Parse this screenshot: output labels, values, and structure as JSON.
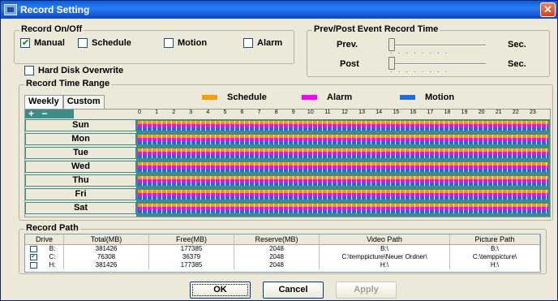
{
  "window": {
    "title": "Record Setting",
    "close_glyph": "✕"
  },
  "record_onoff": {
    "legend": "Record On/Off",
    "manual": {
      "label": "Manual",
      "checked": true
    },
    "schedule": {
      "label": "Schedule",
      "checked": false
    },
    "motion": {
      "label": "Motion",
      "checked": false
    },
    "alarm": {
      "label": "Alarm",
      "checked": false
    }
  },
  "hard_disk_overwrite": {
    "label": "Hard Disk Overwrite",
    "checked": false
  },
  "event_time": {
    "legend": "Prev/Post Event Record Time",
    "prev_label": "Prev.",
    "post_label": "Post",
    "unit": "Sec.",
    "prev_value_fraction": 0,
    "post_value_fraction": 0
  },
  "time_range": {
    "legend": "Record Time Range",
    "tabs": [
      "Weekly",
      "Custom"
    ],
    "legend_items": [
      {
        "label": "Schedule",
        "color": "#ff9900"
      },
      {
        "label": "Alarm",
        "color": "#ff00ff"
      },
      {
        "label": "Motion",
        "color": "#1a6fe0"
      }
    ],
    "tool_plus": "+",
    "tool_minus": "−",
    "hours": [
      "0",
      "1",
      "2",
      "3",
      "4",
      "5",
      "6",
      "7",
      "8",
      "9",
      "10",
      "11",
      "12",
      "13",
      "14",
      "15",
      "16",
      "17",
      "18",
      "19",
      "20",
      "21",
      "22",
      "23"
    ],
    "days": [
      "Sun",
      "Mon",
      "Tue",
      "Wed",
      "Thu",
      "Fri",
      "Sat"
    ]
  },
  "record_path": {
    "legend": "Record Path",
    "columns": [
      "Drive",
      "Total(MB)",
      "Free(MB)",
      "Reserve(MB)",
      "Video Path",
      "Picture Path"
    ],
    "rows": [
      {
        "checked": false,
        "drive": "B:",
        "total": "381426",
        "free": "177385",
        "reserve": "2048",
        "video": "B:\\",
        "picture": "B:\\"
      },
      {
        "checked": true,
        "drive": "C:",
        "total": "76308",
        "free": "36379",
        "reserve": "2048",
        "video": "C:\\temppicture\\Neuer Ordner\\",
        "picture": "C:\\temppicture\\"
      },
      {
        "checked": false,
        "drive": "H:",
        "total": "381426",
        "free": "177385",
        "reserve": "2048",
        "video": "H:\\",
        "picture": "H:\\"
      }
    ]
  },
  "buttons": {
    "ok": "OK",
    "cancel": "Cancel",
    "apply": "Apply"
  }
}
